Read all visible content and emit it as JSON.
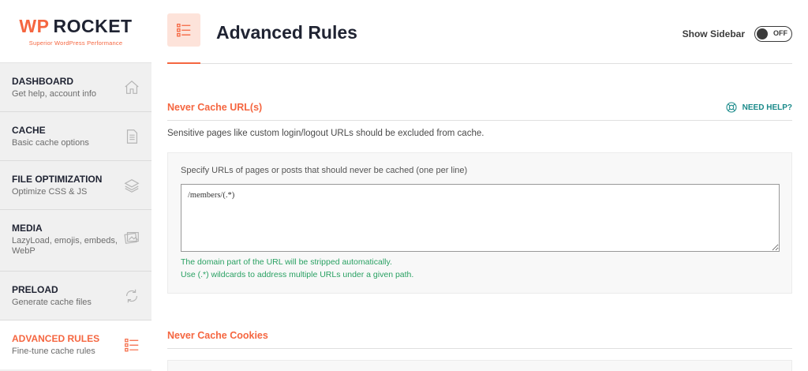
{
  "logo": {
    "brand_prefix": "WP",
    "brand_name": "ROCKET",
    "tagline": "Superior WordPress Performance"
  },
  "sidebar": {
    "items": [
      {
        "title": "DASHBOARD",
        "desc": "Get help, account info",
        "icon": "home-icon"
      },
      {
        "title": "CACHE",
        "desc": "Basic cache options",
        "icon": "document-icon"
      },
      {
        "title": "FILE OPTIMIZATION",
        "desc": "Optimize CSS & JS",
        "icon": "layers-icon"
      },
      {
        "title": "MEDIA",
        "desc": "LazyLoad, emojis, embeds, WebP",
        "icon": "images-icon"
      },
      {
        "title": "PRELOAD",
        "desc": "Generate cache files",
        "icon": "refresh-icon"
      },
      {
        "title": "ADVANCED RULES",
        "desc": "Fine-tune cache rules",
        "icon": "list-icon",
        "active": true
      }
    ]
  },
  "header": {
    "title": "Advanced Rules",
    "show_sidebar_label": "Show Sidebar",
    "toggle_state": "OFF"
  },
  "never_cache_urls": {
    "title": "Never Cache URL(s)",
    "help_label": "NEED HELP?",
    "description": "Sensitive pages like custom login/logout URLs should be excluded from cache.",
    "field_label": "Specify URLs of pages or posts that should never be cached (one per line)",
    "field_value": "/members/(.*)",
    "hint_1": "The domain part of the URL will be stripped automatically.",
    "hint_2": "Use (.*) wildcards to address multiple URLs under a given path."
  },
  "never_cache_cookies": {
    "title": "Never Cache Cookies"
  },
  "colors": {
    "accent": "#f56640",
    "help": "#1a8a8a",
    "hint": "#2aa163",
    "sidebar_bg": "#f0f0f0"
  }
}
